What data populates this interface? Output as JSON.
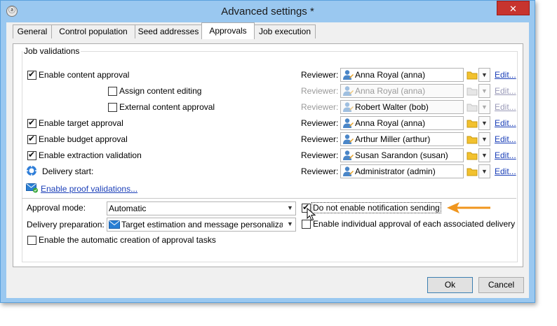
{
  "window": {
    "title": "Advanced settings *",
    "close": "✕"
  },
  "tabs": [
    {
      "label": "General"
    },
    {
      "label": "Control population"
    },
    {
      "label": "Seed addresses"
    },
    {
      "label": "Approvals"
    },
    {
      "label": "Job execution"
    }
  ],
  "group_title": "Job validations",
  "rows": {
    "content": {
      "label": "Enable content approval",
      "checked": true,
      "reviewer_label": "Reviewer:",
      "reviewer": "Anna Royal (anna)",
      "edit": "Edit..."
    },
    "assign": {
      "label": "Assign content editing",
      "checked": false,
      "reviewer_label": "Reviewer:",
      "reviewer": "Anna Royal (anna)",
      "edit": "Edit..."
    },
    "external": {
      "label": "External content approval",
      "checked": false,
      "reviewer_label": "Reviewer:",
      "reviewer": "Robert Walter (bob)",
      "edit": "Edit..."
    },
    "target": {
      "label": "Enable target approval",
      "checked": true,
      "reviewer_label": "Reviewer:",
      "reviewer": "Anna Royal (anna)",
      "edit": "Edit..."
    },
    "budget": {
      "label": "Enable budget approval",
      "checked": true,
      "reviewer_label": "Reviewer:",
      "reviewer": "Arthur Miller (arthur)",
      "edit": "Edit..."
    },
    "extraction": {
      "label": "Enable extraction validation",
      "checked": true,
      "reviewer_label": "Reviewer:",
      "reviewer": "Susan Sarandon (susan)",
      "edit": "Edit..."
    },
    "delivery": {
      "label": "Delivery start:",
      "reviewer_label": "Reviewer:",
      "reviewer": "Administrator (admin)",
      "edit": "Edit..."
    }
  },
  "proof_link": "Enable proof validations...",
  "approval_mode": {
    "label": "Approval mode:",
    "value": "Automatic"
  },
  "delivery_prep": {
    "label": "Delivery preparation:",
    "value": "Target estimation and message personalizat"
  },
  "no_notification": {
    "label": "Do not enable notification sending",
    "checked": true
  },
  "individual_approval": {
    "label": "Enable individual approval of each associated delivery",
    "checked": false
  },
  "auto_tasks": {
    "label": "Enable the automatic creation of approval tasks",
    "checked": false
  },
  "buttons": {
    "ok": "Ok",
    "cancel": "Cancel"
  },
  "colors": {
    "accent_arrow": "#f0961e",
    "link": "#1b3fb8",
    "close": "#c7342e",
    "title_bg": "#9ac8f0"
  }
}
